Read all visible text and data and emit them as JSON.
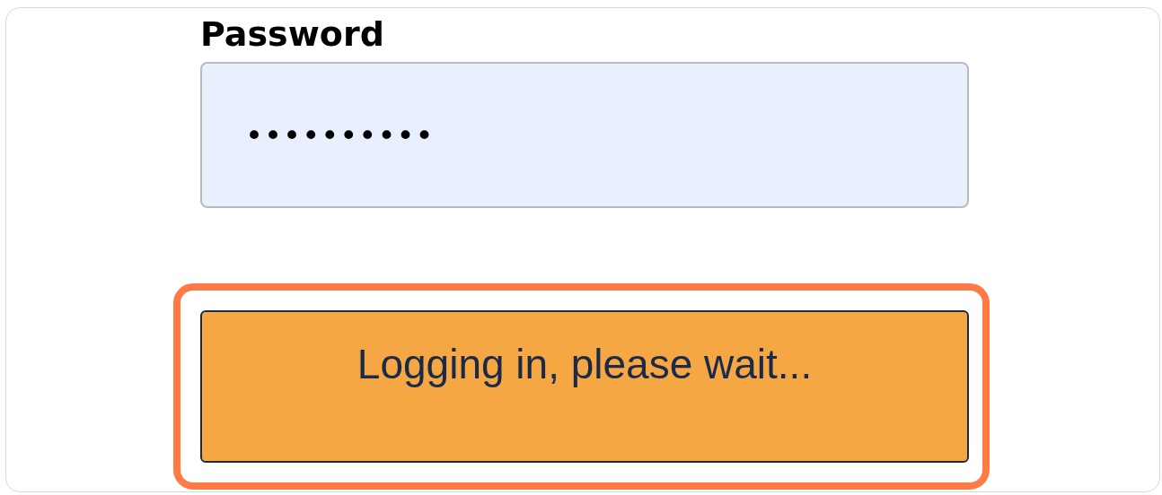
{
  "password_field": {
    "label": "Password",
    "value": "••••••••••"
  },
  "login_button": {
    "label": "Logging in, please wait...",
    "focused": true
  }
}
